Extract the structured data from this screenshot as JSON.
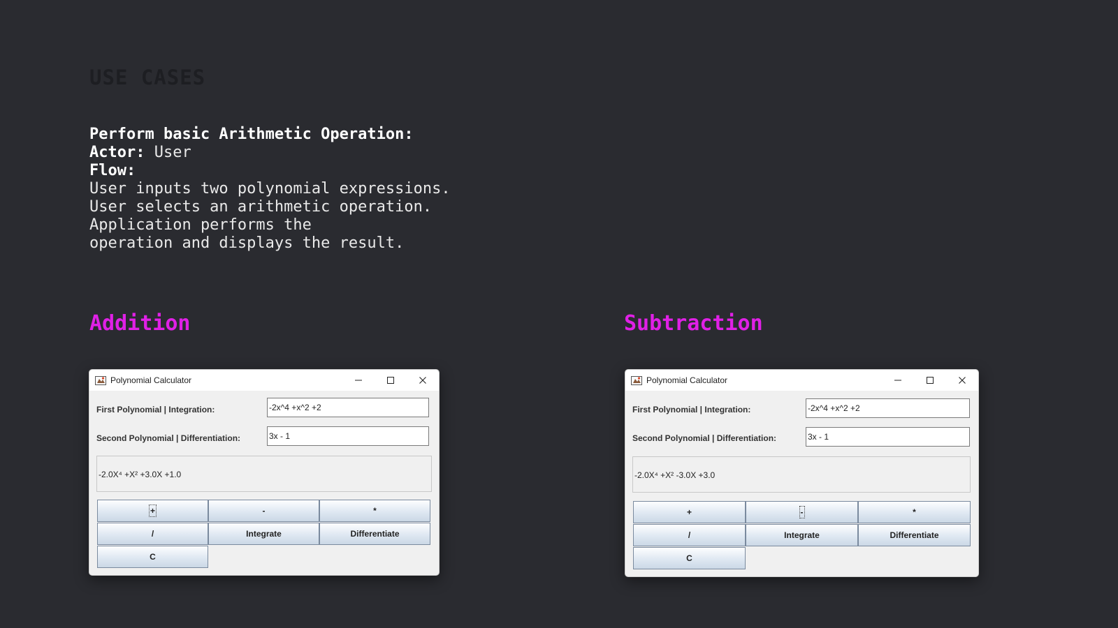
{
  "heading": "USE CASES",
  "usecase": {
    "title": "Perform basic Arithmetic Operation:",
    "actor_label": "Actor:",
    "actor_value": " User",
    "flow_label": "Flow:",
    "flow_lines": [
      "User inputs two polynomial expressions.",
      "User selects an arithmetic operation.",
      "Application performs the",
      "operation and displays the result."
    ]
  },
  "accent_color": "#e020e6",
  "sections": [
    {
      "title": "Addition",
      "window": {
        "title": "Polynomial Calculator",
        "first_label": "First Polynomial | Integration:",
        "first_value": "-2x^4 +x^2 +2",
        "second_label": "Second Polynomial | Differentiation:",
        "second_value": "3x - 1",
        "result": "-2.0X⁴ +X² +3.0X +1.0",
        "buttons": {
          "add": "+",
          "subtract": "-",
          "multiply": "*",
          "divide": "/",
          "integrate": "Integrate",
          "differentiate": "Differentiate",
          "clear": "C"
        }
      }
    },
    {
      "title": "Subtraction",
      "window": {
        "title": "Polynomial Calculator",
        "first_label": "First Polynomial | Integration:",
        "first_value": "-2x^4 +x^2 +2",
        "second_label": "Second Polynomial | Differentiation:",
        "second_value": "3x - 1",
        "result": "-2.0X⁴ +X² -3.0X +3.0",
        "buttons": {
          "add": "+",
          "subtract": "-",
          "multiply": "*",
          "divide": "/",
          "integrate": "Integrate",
          "differentiate": "Differentiate",
          "clear": "C"
        }
      }
    }
  ]
}
